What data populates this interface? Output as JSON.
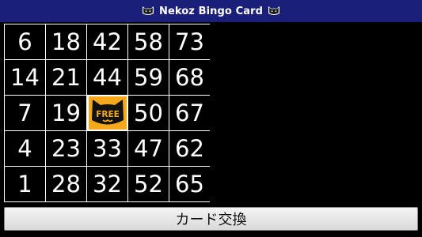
{
  "header": {
    "title": "Nekoz Bingo Card",
    "left_icon": "cat-icon",
    "right_icon": "cat-icon"
  },
  "card": {
    "rows": [
      [
        "6",
        "18",
        "42",
        "58",
        "73"
      ],
      [
        "14",
        "21",
        "44",
        "59",
        "68"
      ],
      [
        "7",
        "19",
        "FREE",
        "50",
        "67"
      ],
      [
        "4",
        "23",
        "33",
        "47",
        "62"
      ],
      [
        "1",
        "28",
        "32",
        "52",
        "65"
      ]
    ],
    "free_label": "FREE",
    "free_icon": "cat-face-icon"
  },
  "footer": {
    "exchange_label": "カード交換"
  },
  "colors": {
    "title_bar": "#1a1f7a",
    "background": "#000000",
    "grid_line": "#ffffff",
    "free_tile": "#f5a91a"
  }
}
